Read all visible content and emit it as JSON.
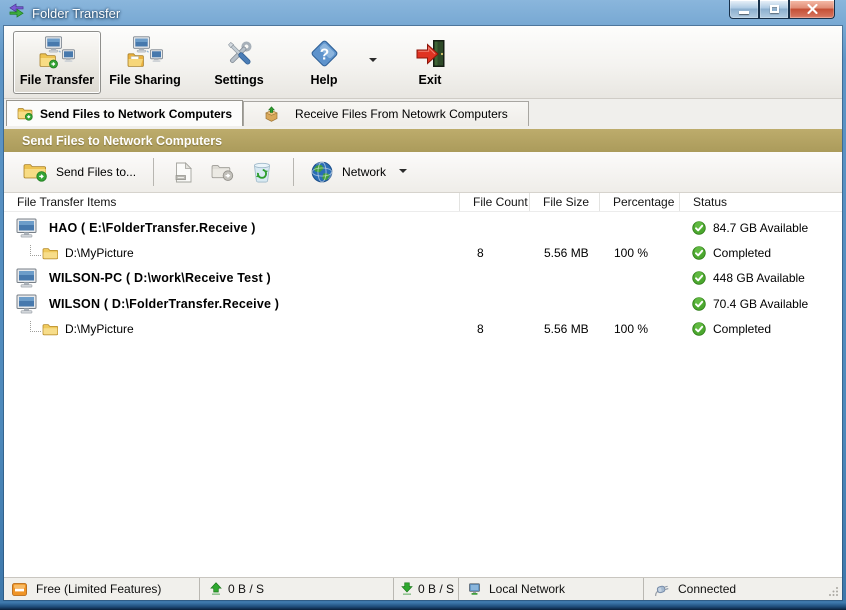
{
  "window": {
    "title": "Folder Transfer"
  },
  "toolbar": {
    "file_transfer": "File Transfer",
    "file_sharing": "File Sharing",
    "settings": "Settings",
    "help": "Help",
    "exit": "Exit"
  },
  "tabs": {
    "send": "Send Files to Network Computers",
    "receive": "Receive Files From Netowrk Computers"
  },
  "section_header": "Send Files to Network Computers",
  "actionbar": {
    "send_files": "Send Files to...",
    "network": "Network"
  },
  "table": {
    "columns": {
      "items": "File Transfer Items",
      "file_count": "File Count",
      "file_size": "File Size",
      "percentage": "Percentage",
      "status": "Status"
    },
    "rows": [
      {
        "type": "computer",
        "name": "HAO ( E:\\FolderTransfer.Receive )",
        "status": "84.7 GB Available"
      },
      {
        "type": "folder",
        "name": "D:\\MyPicture",
        "file_count": "8",
        "file_size": "5.56 MB",
        "percentage": "100 %",
        "status": "Completed"
      },
      {
        "type": "computer",
        "name": "WILSON-PC ( D:\\work\\Receive Test )",
        "status": "448 GB Available"
      },
      {
        "type": "computer",
        "name": "WILSON ( D:\\FolderTransfer.Receive )",
        "status": "70.4 GB Available"
      },
      {
        "type": "folder",
        "name": "D:\\MyPicture",
        "file_count": "8",
        "file_size": "5.56 MB",
        "percentage": "100 %",
        "status": "Completed"
      }
    ]
  },
  "statusbar": {
    "license": "Free (Limited Features)",
    "upload_speed": "0 B / S",
    "download_speed": "0 B / S",
    "network": "Local Network",
    "connection": "Connected"
  },
  "icons": {
    "app": "transfer-arrows",
    "file_transfer": "computers-with-folder",
    "file_sharing": "computers-sharing-folder",
    "settings": "crossed-tools",
    "help": "question-diamond",
    "exit": "door-with-red-arrow",
    "send_tab": "folder-send",
    "receive_tab": "package-receive",
    "status_ok": "green-check-circle",
    "license": "orange-badge",
    "upload": "green-up-arrow",
    "download": "green-down-arrow",
    "local_network": "mini-monitor",
    "connection": "plug"
  },
  "colors": {
    "titlebar_blue": "#4d89bb",
    "header_gold": "#b3a262",
    "status_green": "#3fa435",
    "close_red": "#c9513a",
    "row_folder_yellow": "#efc95c"
  }
}
